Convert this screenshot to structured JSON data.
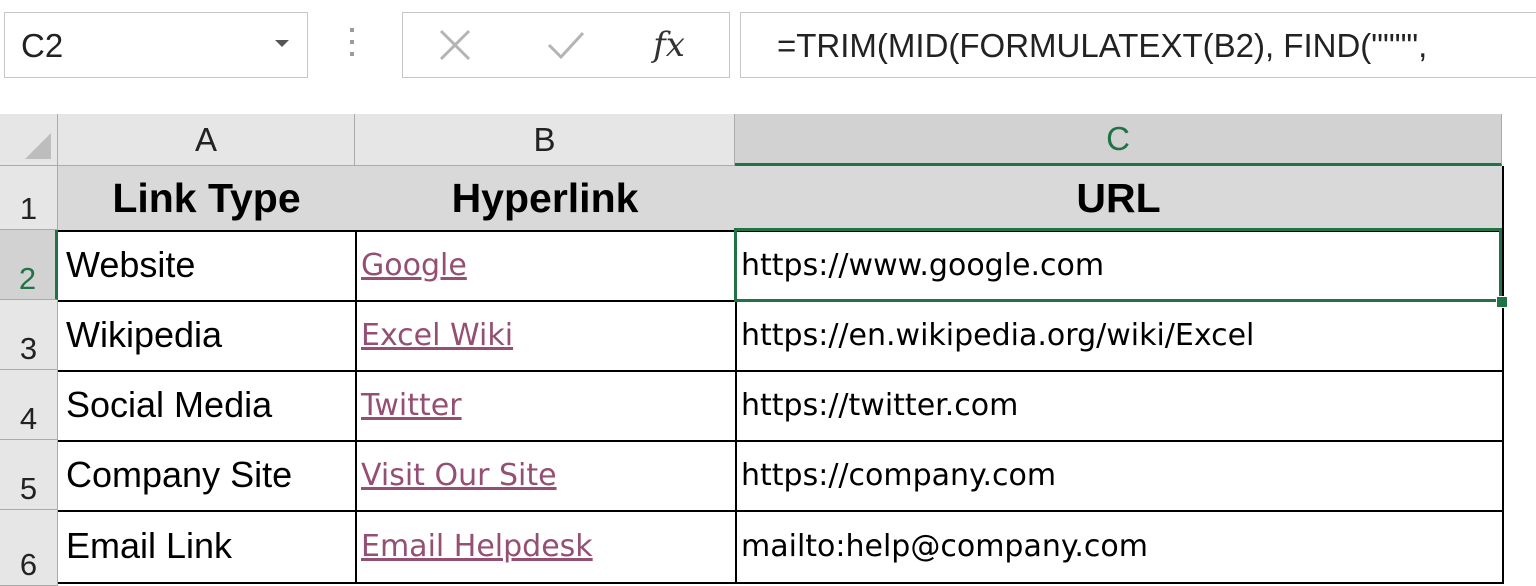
{
  "name_box": {
    "value": "C2"
  },
  "formula_bar": {
    "fx_label": "fx",
    "formula": "=TRIM(MID(FORMULATEXT(B2), FIND(\"\"\"\","
  },
  "columns": [
    "A",
    "B",
    "C"
  ],
  "rows": [
    "1",
    "2",
    "3",
    "4",
    "5",
    "6"
  ],
  "table": {
    "headers": [
      "Link Type",
      "Hyperlink",
      "URL"
    ],
    "rows": [
      {
        "type": "Website",
        "link": "Google",
        "url": "https://www.google.com"
      },
      {
        "type": "Wikipedia",
        "link": "Excel Wiki",
        "url": "https://en.wikipedia.org/wiki/Excel"
      },
      {
        "type": "Social Media",
        "link": "Twitter",
        "url": "https://twitter.com"
      },
      {
        "type": "Company Site",
        "link": "Visit Our Site",
        "url": "https://company.com"
      },
      {
        "type": "Email Link",
        "link": "Email Helpdesk",
        "url": "mailto:help@company.com"
      }
    ]
  },
  "colors": {
    "selection_accent": "#217346",
    "visited_link": "#954f72",
    "header_fill": "#d9d9d9"
  }
}
